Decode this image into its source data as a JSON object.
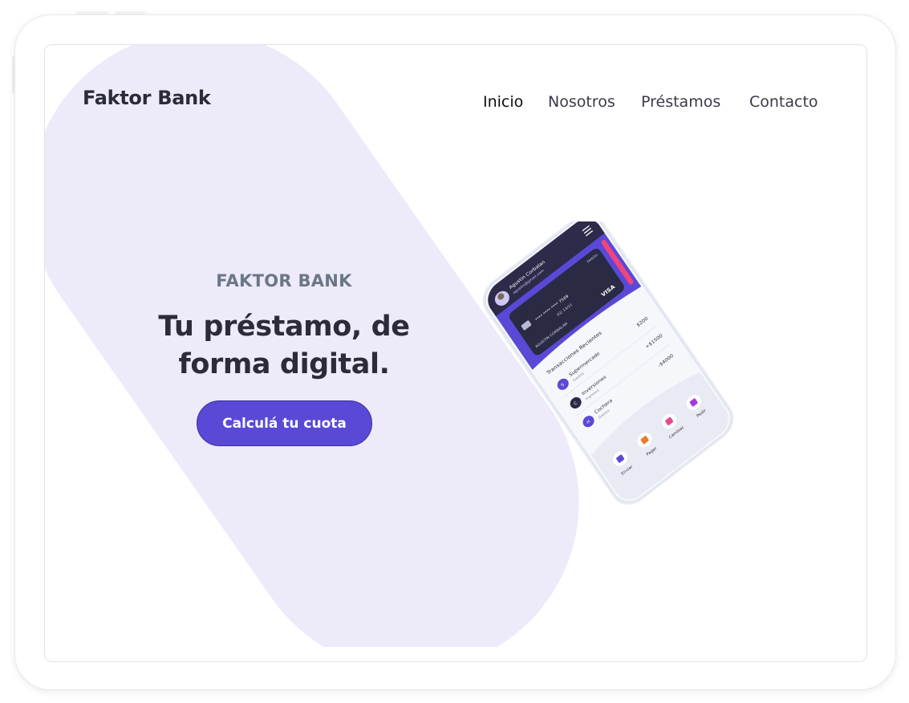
{
  "brand": {
    "name": "Faktor Bank"
  },
  "nav": {
    "items": [
      {
        "label": "Inicio",
        "active": true
      },
      {
        "label": "Nosotros",
        "active": false
      },
      {
        "label": "Préstamos",
        "active": false
      },
      {
        "label": "Contacto",
        "active": false
      }
    ]
  },
  "hero": {
    "kicker": "FAKTOR BANK",
    "headline_line1": "Tu préstamo, de",
    "headline_line2": "forma digital.",
    "cta_label": "Calculá tu cuota"
  },
  "phone": {
    "user_name": "Agustin Corbalan",
    "user_email": "agustin@gmail.com",
    "card": {
      "type_label": "Debito",
      "number_masked": "****   ****   ****   7569",
      "expiry": "02/ 13/21",
      "holder": "AGUSTIN CORBALAN",
      "network": "VISA"
    },
    "section_title": "Transacciones Recientes",
    "transactions": [
      {
        "initial": "S",
        "name": "Supermercado",
        "category": "Gastos",
        "amount": "$200"
      },
      {
        "initial": "C",
        "name": "Inversiones",
        "category": "Ingresos",
        "amount": "+$1500"
      },
      {
        "initial": "H",
        "name": "Cochera",
        "category": "Gastos",
        "amount": "-$4000"
      }
    ],
    "actions": [
      "Enviar",
      "Pagar",
      "Cambiar",
      "Pedir"
    ]
  },
  "colors": {
    "accent": "#5a49d6",
    "blob": "#edeaf9",
    "heading": "#2b2b3a",
    "kicker": "#6b7688",
    "pink": "#f0457c"
  }
}
